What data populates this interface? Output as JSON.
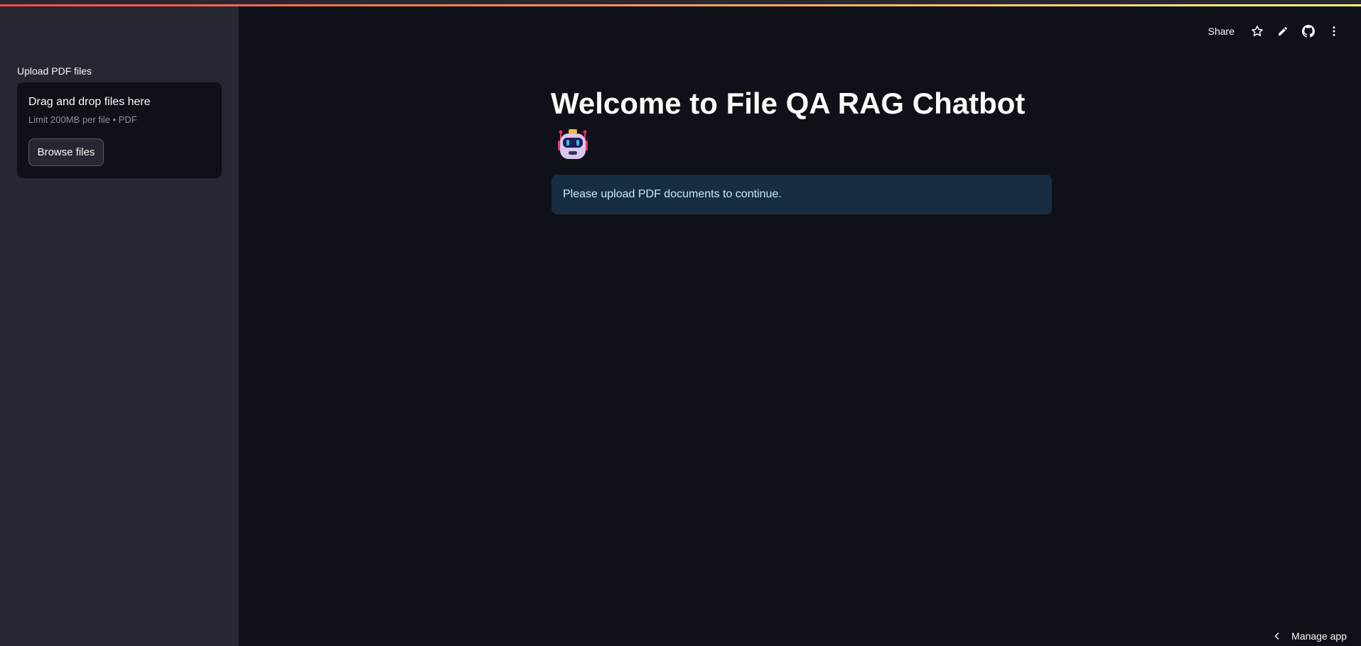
{
  "sidebar": {
    "upload_label": "Upload PDF files",
    "dropzone": {
      "title": "Drag and drop files here",
      "subtitle": "Limit 200MB per file • PDF",
      "browse_label": "Browse files"
    }
  },
  "toolbar": {
    "share_label": "Share",
    "icons": [
      "star-icon",
      "edit-pencil-icon",
      "github-icon",
      "more-vertical-icon"
    ]
  },
  "main": {
    "title": "Welcome to File QA RAG Chatbot",
    "title_emoji": "robot-face-icon",
    "info_message": "Please upload PDF documents to continue."
  },
  "footer": {
    "manage_app_label": "Manage app"
  },
  "colors": {
    "background": "#0e1117",
    "sidebar": "#262730",
    "info_bg": "#172d43",
    "info_text": "#c7ebff",
    "accent_gradient_start": "#ff4b4b",
    "accent_gradient_end": "#fffd80"
  }
}
